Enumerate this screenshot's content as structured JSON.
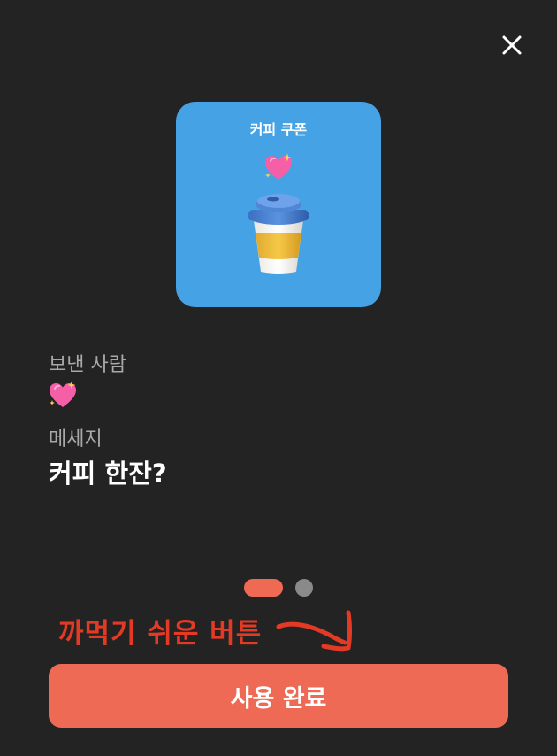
{
  "header": {
    "close_icon": "close-icon"
  },
  "coupon": {
    "title": "커피 쿠폰",
    "card_color": "#45a2e4",
    "decor_icon": "sparkling-heart-icon",
    "image_icon": "coffee-cup-icon"
  },
  "sender": {
    "label": "보낸 사람",
    "value_icon": "sparkling-heart-icon"
  },
  "message": {
    "label": "메세지",
    "text": "커피 한잔?"
  },
  "pager": {
    "total": 2,
    "active_index": 0,
    "active_color": "#ee6a52",
    "inactive_color": "#8a8a8a"
  },
  "annotation": {
    "text": "까먹기 쉬운 버튼",
    "color": "#e23a25"
  },
  "action": {
    "use_label": "사용 완료",
    "color": "#ef6a54"
  },
  "theme": {
    "background": "#232323"
  }
}
